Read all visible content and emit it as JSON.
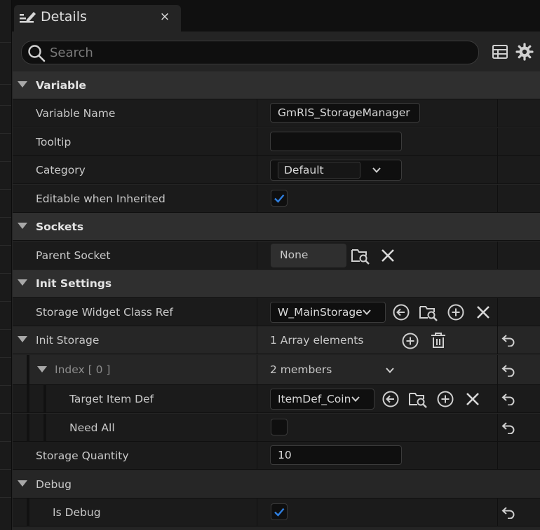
{
  "tab": {
    "title": "Details",
    "close": "×",
    "icon": "pencil-note-icon"
  },
  "search": {
    "placeholder": "Search",
    "value": ""
  },
  "toolbar": {
    "table_icon": "table-view-icon",
    "settings_icon": "gear-icon"
  },
  "sections": {
    "variable": {
      "title": "Variable",
      "variable_name": {
        "label": "Variable Name",
        "value": "GmRIS_StorageManager"
      },
      "tooltip": {
        "label": "Tooltip",
        "value": ""
      },
      "category": {
        "label": "Category",
        "value": "Default"
      },
      "editable": {
        "label": "Editable when Inherited",
        "checked": true
      }
    },
    "sockets": {
      "title": "Sockets",
      "parent_socket": {
        "label": "Parent Socket",
        "value": "None"
      }
    },
    "init_settings": {
      "title": "Init Settings",
      "widget_class": {
        "label": "Storage Widget Class Ref",
        "value": "W_MainStorage"
      },
      "init_storage": {
        "label": "Init Storage",
        "value": "1 Array elements"
      },
      "index": {
        "label": "Index [ 0 ]",
        "value": "2 members"
      },
      "target_item": {
        "label": "Target Item Def",
        "value": "ItemDef_Coin"
      },
      "need_all": {
        "label": "Need All",
        "checked": false
      },
      "quantity": {
        "label": "Storage Quantity",
        "value": "10"
      }
    },
    "debug": {
      "title": "Debug",
      "is_debug": {
        "label": "Is Debug",
        "checked": true
      }
    }
  },
  "colors": {
    "checkmark": "#2f7fe0",
    "panel_bg": "#242424",
    "row_bg": "#1b1b1b",
    "input_bg": "#0f0f0f"
  }
}
